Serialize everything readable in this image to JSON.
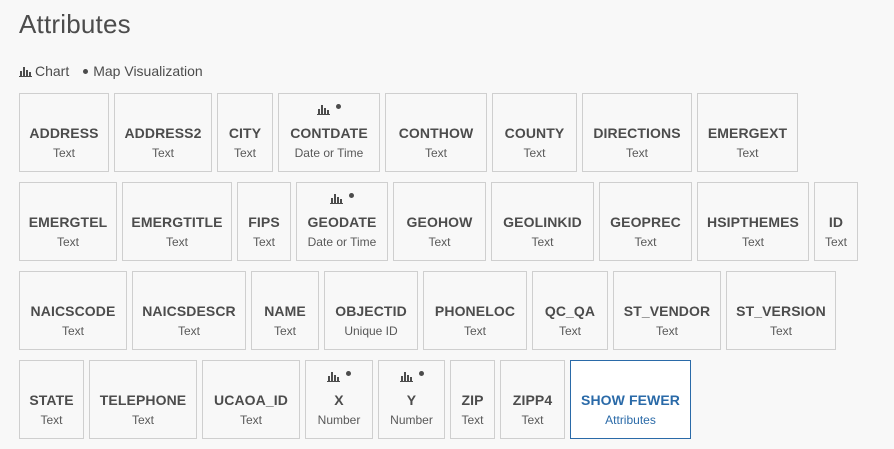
{
  "title": "Attributes",
  "legend": {
    "chart_label": "Chart",
    "map_label": "Map Visualization",
    "chart_icon": "bar-chart-icon",
    "map_icon": "dot-icon"
  },
  "rows": [
    [
      {
        "name": "ADDRESS",
        "type": "Text"
      },
      {
        "name": "ADDRESS2",
        "type": "Text"
      },
      {
        "name": "CITY",
        "type": "Text"
      },
      {
        "name": "CONTDATE",
        "type": "Date or Time",
        "chart": true,
        "map": true
      },
      {
        "name": "CONTHOW",
        "type": "Text"
      },
      {
        "name": "COUNTY",
        "type": "Text"
      },
      {
        "name": "DIRECTIONS",
        "type": "Text"
      },
      {
        "name": "EMERGEXT",
        "type": "Text"
      }
    ],
    [
      {
        "name": "EMERGTEL",
        "type": "Text"
      },
      {
        "name": "EMERGTITLE",
        "type": "Text"
      },
      {
        "name": "FIPS",
        "type": "Text"
      },
      {
        "name": "GEODATE",
        "type": "Date or Time",
        "chart": true,
        "map": true
      },
      {
        "name": "GEOHOW",
        "type": "Text"
      },
      {
        "name": "GEOLINKID",
        "type": "Text"
      },
      {
        "name": "GEOPREC",
        "type": "Text"
      },
      {
        "name": "HSIPTHEMES",
        "type": "Text"
      },
      {
        "name": "ID",
        "type": "Text"
      }
    ],
    [
      {
        "name": "NAICSCODE",
        "type": "Text"
      },
      {
        "name": "NAICSDESCR",
        "type": "Text"
      },
      {
        "name": "NAME",
        "type": "Text"
      },
      {
        "name": "OBJECTID",
        "type": "Unique ID"
      },
      {
        "name": "PHONELOC",
        "type": "Text"
      },
      {
        "name": "QC_QA",
        "type": "Text"
      },
      {
        "name": "ST_VENDOR",
        "type": "Text"
      },
      {
        "name": "ST_VERSION",
        "type": "Text"
      }
    ],
    [
      {
        "name": "STATE",
        "type": "Text"
      },
      {
        "name": "TELEPHONE",
        "type": "Text"
      },
      {
        "name": "UCAOA_ID",
        "type": "Text"
      },
      {
        "name": "X",
        "type": "Number",
        "chart": true,
        "map": true
      },
      {
        "name": "Y",
        "type": "Number",
        "chart": true,
        "map": true
      },
      {
        "name": "ZIP",
        "type": "Text"
      },
      {
        "name": "ZIPP4",
        "type": "Text"
      },
      {
        "name": "SHOW FEWER",
        "type": "Attributes",
        "accent": true
      }
    ]
  ],
  "colors": {
    "accent": "#2a6aa8",
    "border": "#cfcfcf",
    "text": "#4c4c4c",
    "background": "#f8f8f8"
  }
}
